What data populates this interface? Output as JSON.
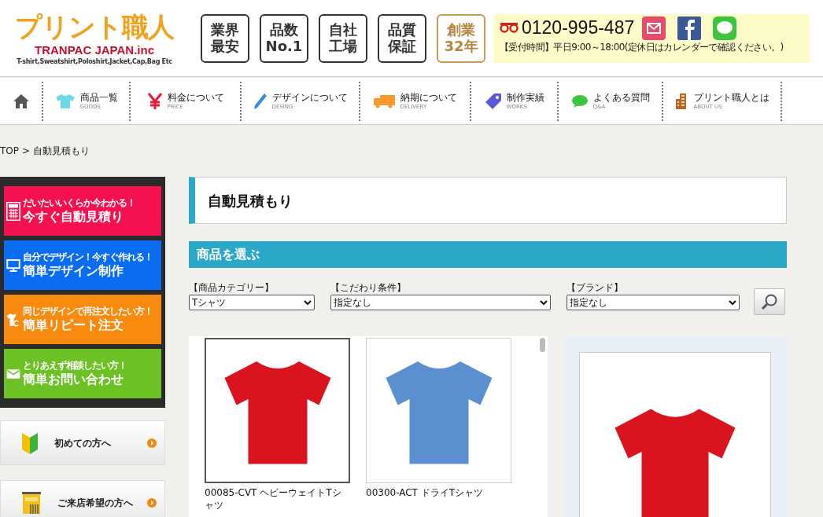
{
  "logo": {
    "title": "プリント職人",
    "company": "TRANPAC JAPAN.inc",
    "tagline": "T-shirt,Sweatshirt,Poloshirt,Jacket,Cap,Bag Etc"
  },
  "badges": [
    {
      "lines": [
        "業界",
        "最安"
      ],
      "kind": "plain"
    },
    {
      "lines": [
        "品数",
        "No.1"
      ],
      "kind": "plain"
    },
    {
      "lines": [
        "自社",
        "工場"
      ],
      "kind": "plain"
    },
    {
      "lines": [
        "品質",
        "保証"
      ],
      "kind": "plain"
    },
    {
      "lines": [
        "創業",
        "32年"
      ],
      "kind": "gold"
    }
  ],
  "contact": {
    "phone": "0120-995-487",
    "hours": "【受付時間】平日9:00～18:00(定休日はカレンダーで確認ください。)"
  },
  "nav": [
    {
      "kind": "home"
    },
    {
      "kind": "shirt",
      "label": "商品一覧",
      "sub": "GOODS"
    },
    {
      "kind": "yen",
      "label": "料金について",
      "sub": "PRICE"
    },
    {
      "kind": "pen",
      "label": "デザインについて",
      "sub": "DESING"
    },
    {
      "kind": "truck",
      "label": "納期について",
      "sub": "DELIVERY"
    },
    {
      "kind": "tag",
      "label": "制作実績",
      "sub": "WORKS"
    },
    {
      "kind": "chat",
      "label": "よくある質問",
      "sub": "Q&A"
    },
    {
      "kind": "building",
      "label": "プリント職人とは",
      "sub": "ABOUT US"
    }
  ],
  "breadcrumb": {
    "items": [
      "TOP",
      "自動見積もり"
    ],
    "separator": ">"
  },
  "side_buttons": [
    {
      "kind": "calculator",
      "sub": "だいたいいくらか今わかる！",
      "label": "今すぐ自動見積り",
      "color": "#f5114f"
    },
    {
      "kind": "monitor",
      "sub": "自分でデザイン！今すぐ作れる！",
      "label": "簡単デザイン制作",
      "color": "#0a6cf0"
    },
    {
      "kind": "shirt",
      "sub": "同じデザインで再注文したい方！",
      "label": "簡単リピート注文",
      "color": "#f98a10"
    },
    {
      "kind": "mail",
      "sub": "とりあえず相談したい方！",
      "label": "簡単お問い合わせ",
      "color": "#6cc124"
    }
  ],
  "side_links": [
    {
      "kind": "leaf",
      "label": "初めての方へ"
    },
    {
      "kind": "store",
      "label": "ご来店希望の方へ"
    }
  ],
  "page_title": "自動見積もり",
  "section_title": "商品を選ぶ",
  "filters": [
    {
      "label": "【商品カテゴリー】",
      "value": "Tシャツ"
    },
    {
      "label": "【こだわり条件】",
      "value": "指定なし"
    },
    {
      "label": "【ブランド】",
      "value": "指定なし"
    }
  ],
  "products": [
    {
      "name": "00085-CVT ヘビーウェイトTシャツ",
      "selected": true,
      "color": "#d9141e"
    },
    {
      "name": "00300-ACT ドライTシャツ",
      "selected": false,
      "color": "#5b8fcf"
    }
  ],
  "preview": {
    "color": "#d9141e"
  }
}
